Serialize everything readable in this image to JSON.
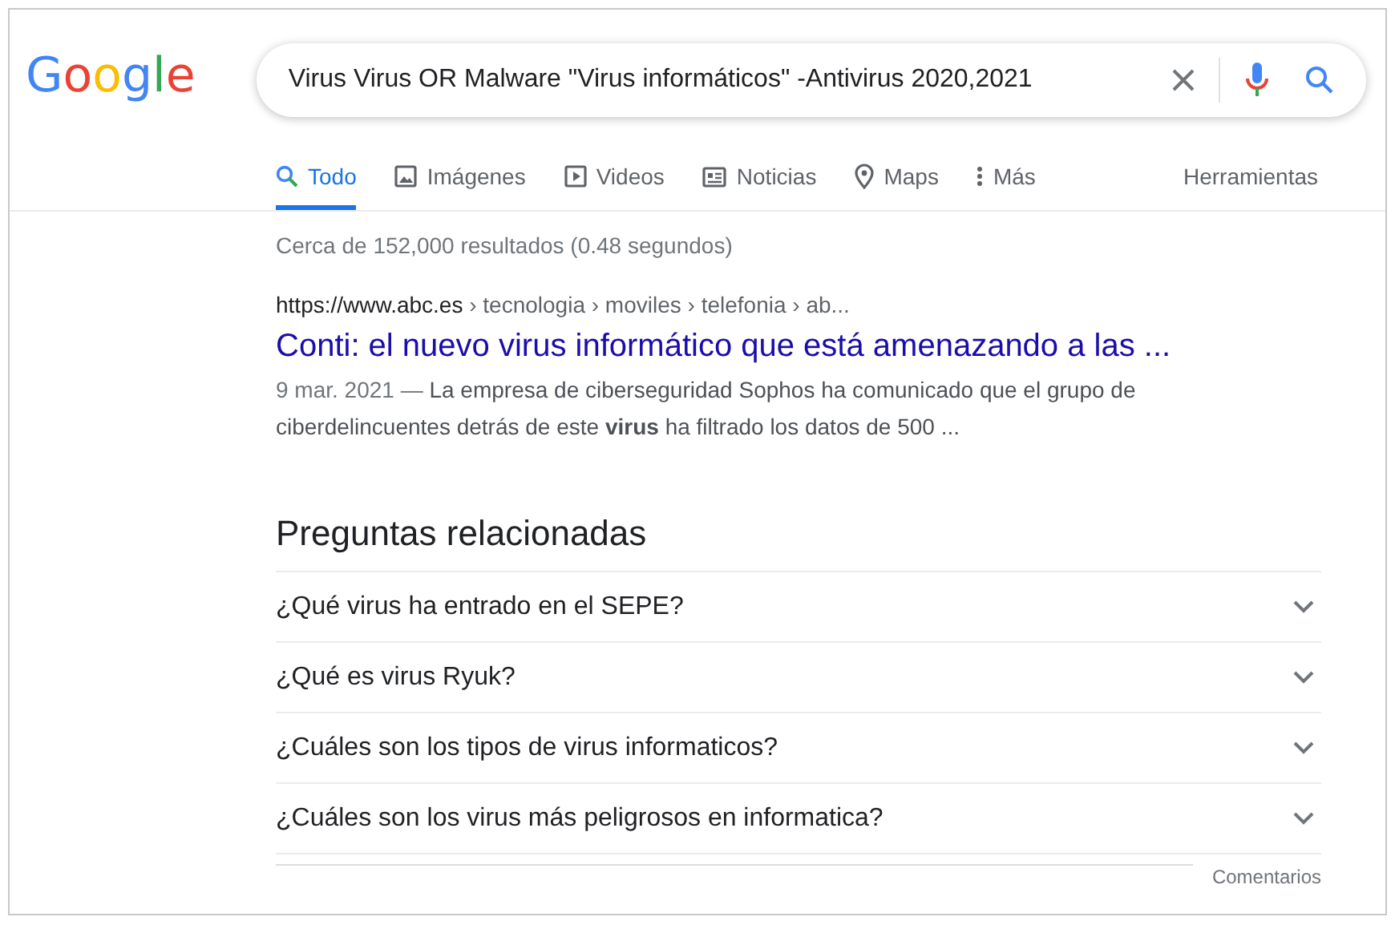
{
  "logo": "Google",
  "search": {
    "value": "Virus Virus OR Malware \"Virus informáticos\" -Antivirus 2020,2021"
  },
  "tabs": [
    {
      "label": "Todo",
      "kind": "search",
      "selected": true
    },
    {
      "label": "Imágenes",
      "kind": "image",
      "selected": false
    },
    {
      "label": "Videos",
      "kind": "video",
      "selected": false
    },
    {
      "label": "Noticias",
      "kind": "news",
      "selected": false
    },
    {
      "label": "Maps",
      "kind": "pin",
      "selected": false
    },
    {
      "label": "Más",
      "kind": "more",
      "selected": false
    }
  ],
  "tools": "Herramientas",
  "stats": "Cerca de 152,000 resultados (0.48 segundos)",
  "result": {
    "url": "https://www.abc.es",
    "breadcrumb": " › tecnologia › moviles › telefonia › ab...",
    "title": "Conti: el nuevo virus informático que está amenazando a las ...",
    "date": "9 mar. 2021 — ",
    "snippet": "La empresa de ciberseguridad Sophos ha comunicado que el grupo de ciberdelincuentes detrás de este **virus** ha filtrado los datos de 500 ..."
  },
  "related": {
    "heading": "Preguntas relacionadas",
    "questions": [
      {
        "text": "¿Qué virus ha entrado en el SEPE?",
        "expanded": false
      },
      {
        "text": "¿Qué es virus Ryuk?",
        "expanded": false
      },
      {
        "text": "¿Cuáles son los tipos de virus informaticos?",
        "expanded": false
      },
      {
        "text": "¿Cuáles son los virus más peligrosos en informatica?",
        "expanded": false
      }
    ]
  },
  "feedback": "Comentarios"
}
